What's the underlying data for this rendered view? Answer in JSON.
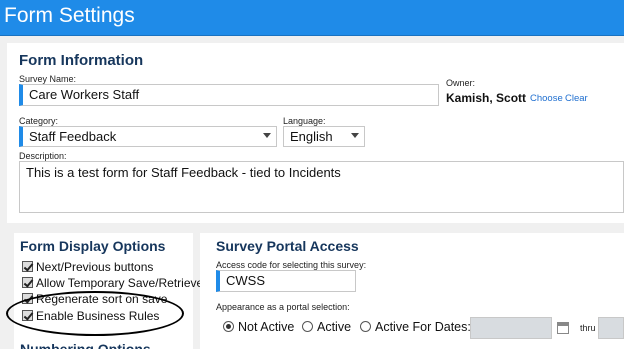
{
  "title": "Form Settings",
  "form_info": {
    "heading": "Form Information",
    "survey_name_label": "Survey Name:",
    "survey_name_value": "Care Workers Staff",
    "owner_label": "Owner:",
    "owner_value": "Kamish, Scott",
    "choose_link": "Choose",
    "clear_link": "Clear",
    "category_label": "Category:",
    "category_value": "Staff Feedback",
    "language_label": "Language:",
    "language_value": "English",
    "description_label": "Description:",
    "description_value": "This is a test form for Staff Feedback - tied to Incidents"
  },
  "display_options": {
    "heading": "Form Display Options",
    "items": [
      {
        "label": "Next/Previous buttons",
        "checked": true
      },
      {
        "label": "Allow Temporary Save/Retrieve",
        "checked": true
      },
      {
        "label": "Regenerate sort on save",
        "checked": true
      },
      {
        "label": "Enable Business Rules",
        "checked": true
      }
    ],
    "next_heading": "Numbering Options"
  },
  "portal": {
    "heading": "Survey Portal Access",
    "access_code_label": "Access code for selecting this survey:",
    "access_code_value": "CWSS",
    "appearance_label": "Appearance as a portal selection:",
    "options": [
      "Not Active",
      "Active",
      "Active For Dates:"
    ],
    "selected": "Not Active",
    "thru_label": "thru"
  },
  "colors": {
    "accent": "#1f8be8",
    "heading": "#16365c",
    "link": "#1f6fd0"
  }
}
